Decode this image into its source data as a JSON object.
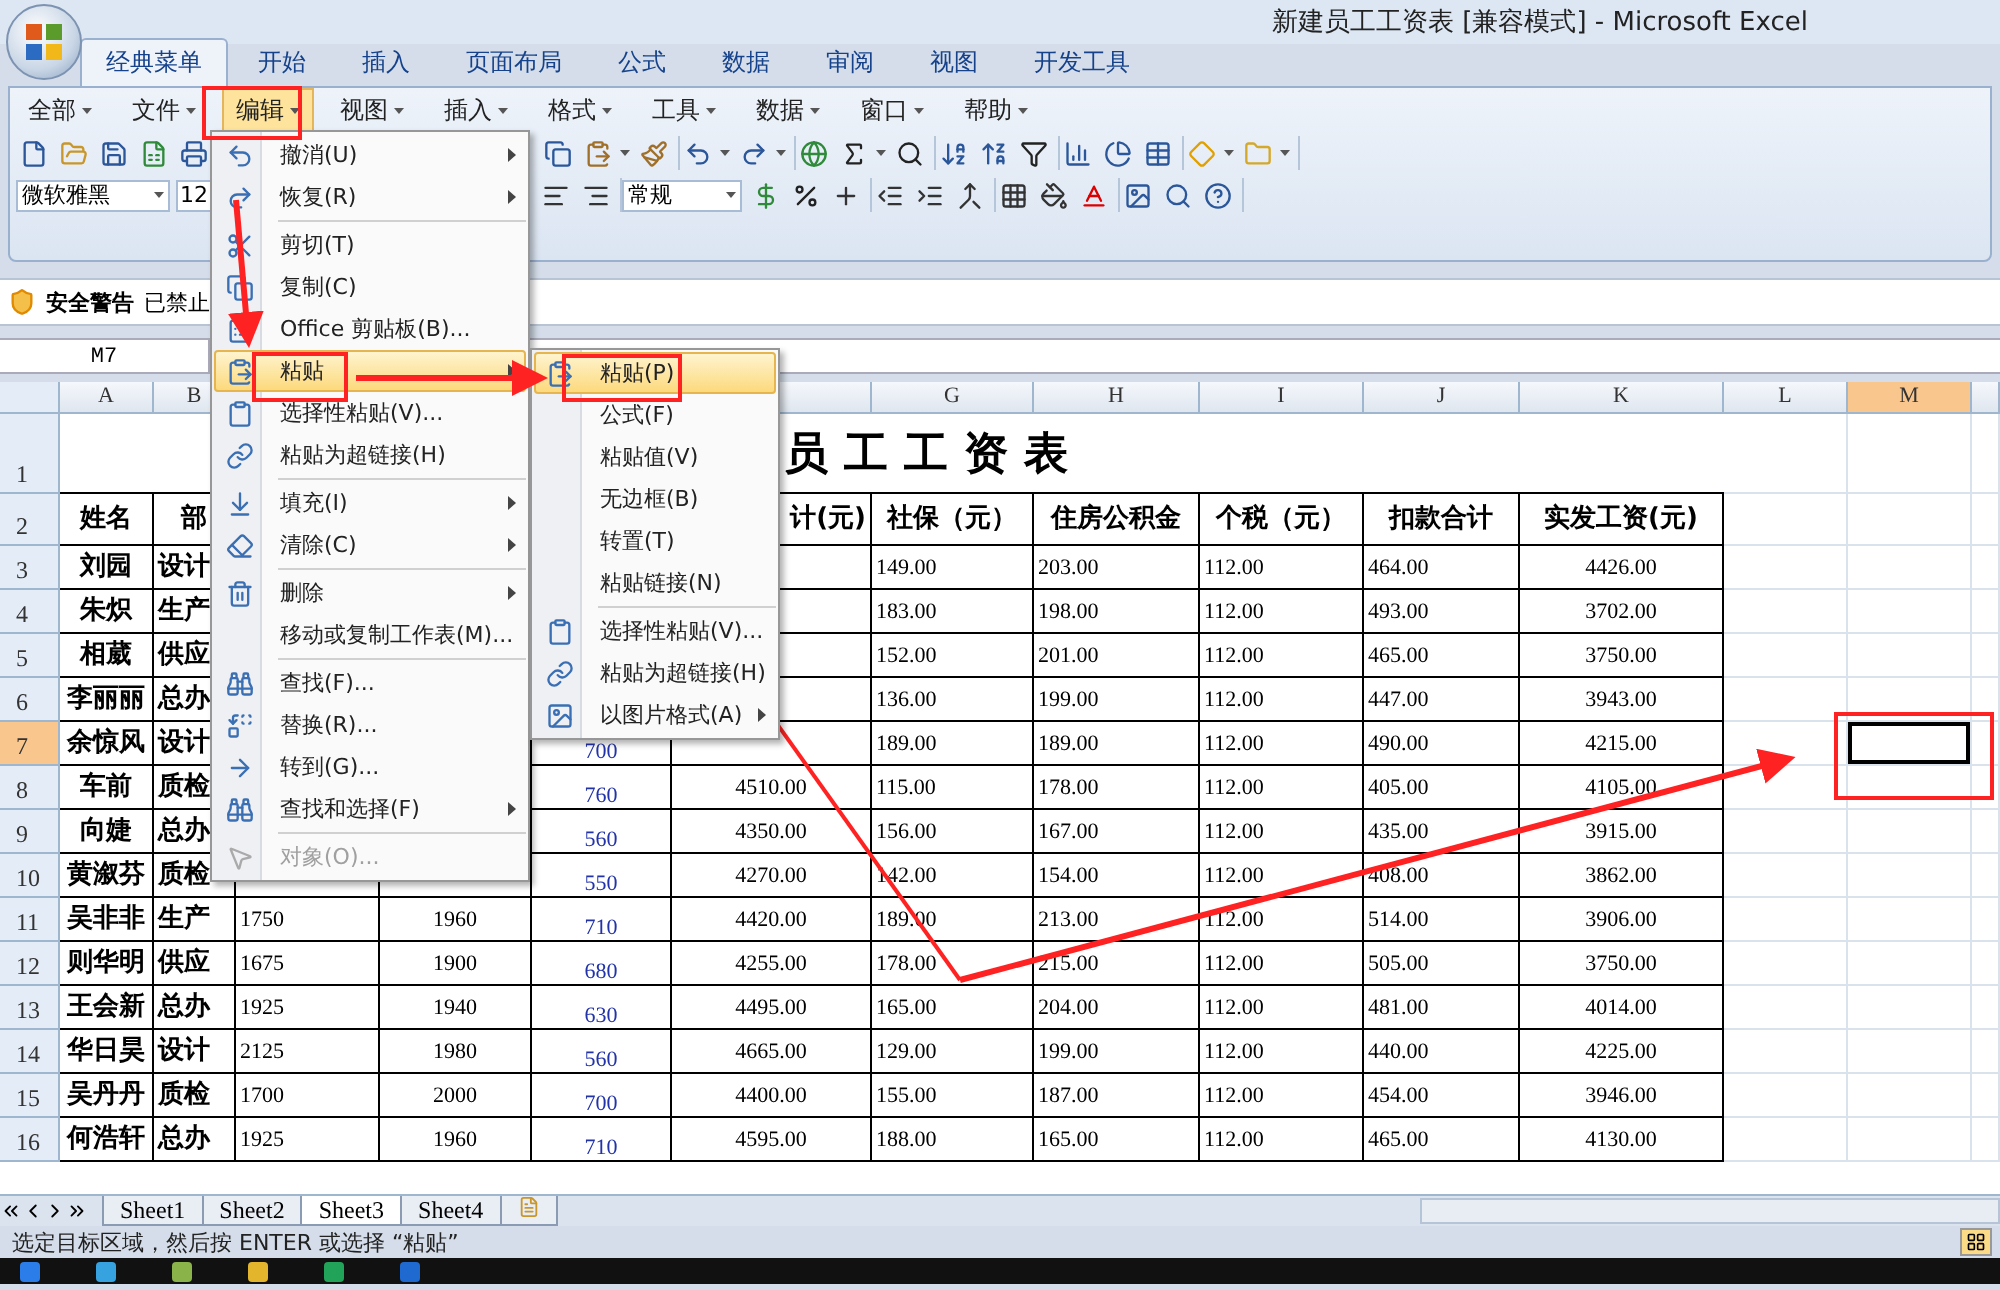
{
  "window": {
    "title": "新建员工工资表  [兼容模式] - Microsoft Excel"
  },
  "ribbon_tabs": [
    {
      "label": "经典菜单",
      "selected": true
    },
    {
      "label": "开始",
      "selected": false
    },
    {
      "label": "插入",
      "selected": false
    },
    {
      "label": "页面布局",
      "selected": false
    },
    {
      "label": "公式",
      "selected": false
    },
    {
      "label": "数据",
      "selected": false
    },
    {
      "label": "审阅",
      "selected": false
    },
    {
      "label": "视图",
      "selected": false
    },
    {
      "label": "开发工具",
      "selected": false
    }
  ],
  "menu_bar": [
    {
      "label": "全部",
      "selected": false
    },
    {
      "label": "文件",
      "selected": false
    },
    {
      "label": "编辑",
      "selected": true
    },
    {
      "label": "视图",
      "selected": false
    },
    {
      "label": "插入",
      "selected": false
    },
    {
      "label": "格式",
      "selected": false
    },
    {
      "label": "工具",
      "selected": false
    },
    {
      "label": "数据",
      "selected": false
    },
    {
      "label": "窗口",
      "selected": false
    },
    {
      "label": "帮助",
      "selected": false
    }
  ],
  "toolbar": {
    "font": "微软雅黑",
    "size": "12",
    "number_format": "常规"
  },
  "security_bar": {
    "title": "安全警告",
    "message": "已禁止"
  },
  "name_box": "M7",
  "sheet": {
    "columns": [
      {
        "label": "A",
        "selected": false
      },
      {
        "label": "B",
        "selected": false
      },
      null,
      null,
      null,
      null,
      {
        "label": "G",
        "selected": false
      },
      {
        "label": "H",
        "selected": false
      },
      {
        "label": "I",
        "selected": false
      },
      {
        "label": "J",
        "selected": false
      },
      {
        "label": "K",
        "selected": false
      },
      {
        "label": "L",
        "selected": false
      },
      {
        "label": "M",
        "selected": true
      }
    ],
    "rows": [
      {
        "header": "1",
        "selected": false,
        "title": "员工工资表"
      },
      {
        "header": "2",
        "selected": false,
        "cells": [
          "姓名",
          "部",
          null,
          null,
          null,
          "计(元)",
          "社保（元）",
          "住房公积金",
          "个税（元）",
          "扣款合计",
          "实发工资(元)",
          null,
          null
        ]
      },
      {
        "header": "3",
        "selected": false,
        "cells": [
          "刘园",
          "设计",
          null,
          null,
          null,
          null,
          "149.00",
          "203.00",
          "112.00",
          "464.00",
          "4426.00",
          null,
          null
        ]
      },
      {
        "header": "4",
        "selected": false,
        "cells": [
          "朱炽",
          "生产",
          null,
          null,
          null,
          null,
          "183.00",
          "198.00",
          "112.00",
          "493.00",
          "3702.00",
          null,
          null
        ]
      },
      {
        "header": "5",
        "selected": false,
        "cells": [
          "相葳",
          "供应",
          null,
          null,
          null,
          null,
          "152.00",
          "201.00",
          "112.00",
          "465.00",
          "3750.00",
          null,
          null
        ]
      },
      {
        "header": "6",
        "selected": false,
        "cells": [
          "李丽丽",
          "总办",
          null,
          null,
          null,
          null,
          "136.00",
          "199.00",
          "112.00",
          "447.00",
          "3943.00",
          null,
          null
        ]
      },
      {
        "header": "7",
        "selected": true,
        "cells": [
          "余惊风",
          "设计",
          null,
          null,
          "700",
          null,
          "189.00",
          "189.00",
          "112.00",
          "490.00",
          "4215.00",
          null,
          null
        ]
      },
      {
        "header": "8",
        "selected": false,
        "cells": [
          "车前",
          "质检",
          null,
          null,
          "760",
          "4510.00",
          "115.00",
          "178.00",
          "112.00",
          "405.00",
          "4105.00",
          null,
          null
        ]
      },
      {
        "header": "9",
        "selected": false,
        "cells": [
          "向婕",
          "总办",
          null,
          null,
          "560",
          "4350.00",
          "156.00",
          "167.00",
          "112.00",
          "435.00",
          "3915.00",
          null,
          null
        ]
      },
      {
        "header": "10",
        "selected": false,
        "cells": [
          "黄溆芬",
          "质检",
          null,
          null,
          "550",
          "4270.00",
          "142.00",
          "154.00",
          "112.00",
          "408.00",
          "3862.00",
          null,
          null
        ]
      },
      {
        "header": "11",
        "selected": false,
        "cells": [
          "吴非非",
          "生产",
          "1750",
          "1960",
          "710",
          "4420.00",
          "189.00",
          "213.00",
          "112.00",
          "514.00",
          "3906.00",
          null,
          null
        ]
      },
      {
        "header": "12",
        "selected": false,
        "cells": [
          "则华明",
          "供应",
          "1675",
          "1900",
          "680",
          "4255.00",
          "178.00",
          "215.00",
          "112.00",
          "505.00",
          "3750.00",
          null,
          null
        ]
      },
      {
        "header": "13",
        "selected": false,
        "cells": [
          "王会新",
          "总办",
          "1925",
          "1940",
          "630",
          "4495.00",
          "165.00",
          "204.00",
          "112.00",
          "481.00",
          "4014.00",
          null,
          null
        ]
      },
      {
        "header": "14",
        "selected": false,
        "cells": [
          "华日昊",
          "设计",
          "2125",
          "1980",
          "560",
          "4665.00",
          "129.00",
          "199.00",
          "112.00",
          "440.00",
          "4225.00",
          null,
          null
        ]
      },
      {
        "header": "15",
        "selected": false,
        "cells": [
          "吴丹丹",
          "质检",
          "1700",
          "2000",
          "700",
          "4400.00",
          "155.00",
          "187.00",
          "112.00",
          "454.00",
          "3946.00",
          null,
          null
        ]
      },
      {
        "header": "16",
        "selected": false,
        "cells": [
          "何浩轩",
          "总办",
          "1925",
          "1960",
          "710",
          "4595.00",
          "188.00",
          "165.00",
          "112.00",
          "465.00",
          "4130.00",
          null,
          null
        ]
      }
    ]
  },
  "sheet_tabs": [
    {
      "label": "Sheet1",
      "selected": false
    },
    {
      "label": "Sheet2",
      "selected": false
    },
    {
      "label": "Sheet3",
      "selected": true
    },
    {
      "label": "Sheet4",
      "selected": false
    }
  ],
  "status_bar": "选定目标区域，然后按 ENTER 或选择 “粘贴”",
  "edit_menu": [
    {
      "kind": "item",
      "label": "撤消(U)",
      "submenu": true,
      "highlighted": false,
      "disabled": false
    },
    {
      "kind": "item",
      "label": "恢复(R)",
      "submenu": true,
      "highlighted": false,
      "disabled": false
    },
    {
      "kind": "separator"
    },
    {
      "kind": "item",
      "label": "剪切(T)",
      "submenu": false,
      "highlighted": false,
      "disabled": false
    },
    {
      "kind": "item",
      "label": "复制(C)",
      "submenu": false,
      "highlighted": false,
      "disabled": false
    },
    {
      "kind": "item",
      "label": "Office 剪贴板(B)...",
      "submenu": false,
      "highlighted": false,
      "disabled": false
    },
    {
      "kind": "item",
      "label": "粘贴",
      "submenu": true,
      "highlighted": true,
      "disabled": false
    },
    {
      "kind": "item",
      "label": "选择性粘贴(V)...",
      "submenu": false,
      "highlighted": false,
      "disabled": false
    },
    {
      "kind": "item",
      "label": "粘贴为超链接(H)",
      "submenu": false,
      "highlighted": false,
      "disabled": false
    },
    {
      "kind": "separator"
    },
    {
      "kind": "item",
      "label": "填充(I)",
      "submenu": true,
      "highlighted": false,
      "disabled": false
    },
    {
      "kind": "item",
      "label": "清除(C)",
      "submenu": true,
      "highlighted": false,
      "disabled": false
    },
    {
      "kind": "separator"
    },
    {
      "kind": "item",
      "label": "删除",
      "submenu": true,
      "highlighted": false,
      "disabled": false
    },
    {
      "kind": "item",
      "label": "移动或复制工作表(M)...",
      "submenu": false,
      "highlighted": false,
      "disabled": false
    },
    {
      "kind": "separator"
    },
    {
      "kind": "item",
      "label": "查找(F)...",
      "submenu": false,
      "highlighted": false,
      "disabled": false
    },
    {
      "kind": "item",
      "label": "替换(R)...",
      "submenu": false,
      "highlighted": false,
      "disabled": false
    },
    {
      "kind": "item",
      "label": "转到(G)...",
      "submenu": false,
      "highlighted": false,
      "disabled": false
    },
    {
      "kind": "item",
      "label": "查找和选择(F)",
      "submenu": true,
      "highlighted": false,
      "disabled": false
    },
    {
      "kind": "separator"
    },
    {
      "kind": "item",
      "label": "对象(O)...",
      "submenu": false,
      "highlighted": false,
      "disabled": true
    }
  ],
  "paste_menu": [
    {
      "kind": "item",
      "label": "粘贴(P)",
      "submenu": false,
      "highlighted": true,
      "disabled": false
    },
    {
      "kind": "item",
      "label": "公式(F)",
      "submenu": false,
      "highlighted": false,
      "disabled": false
    },
    {
      "kind": "item",
      "label": "粘贴值(V)",
      "submenu": false,
      "highlighted": false,
      "disabled": false
    },
    {
      "kind": "item",
      "label": "无边框(B)",
      "submenu": false,
      "highlighted": false,
      "disabled": false
    },
    {
      "kind": "item",
      "label": "转置(T)",
      "submenu": false,
      "highlighted": false,
      "disabled": false
    },
    {
      "kind": "item",
      "label": "粘贴链接(N)",
      "submenu": false,
      "highlighted": false,
      "disabled": false
    },
    {
      "kind": "separator"
    },
    {
      "kind": "item",
      "label": "选择性粘贴(V)...",
      "submenu": false,
      "highlighted": false,
      "disabled": false
    },
    {
      "kind": "item",
      "label": "粘贴为超链接(H)",
      "submenu": false,
      "highlighted": false,
      "disabled": false
    },
    {
      "kind": "item",
      "label": "以图片格式(A)",
      "submenu": true,
      "highlighted": false,
      "disabled": false
    }
  ]
}
